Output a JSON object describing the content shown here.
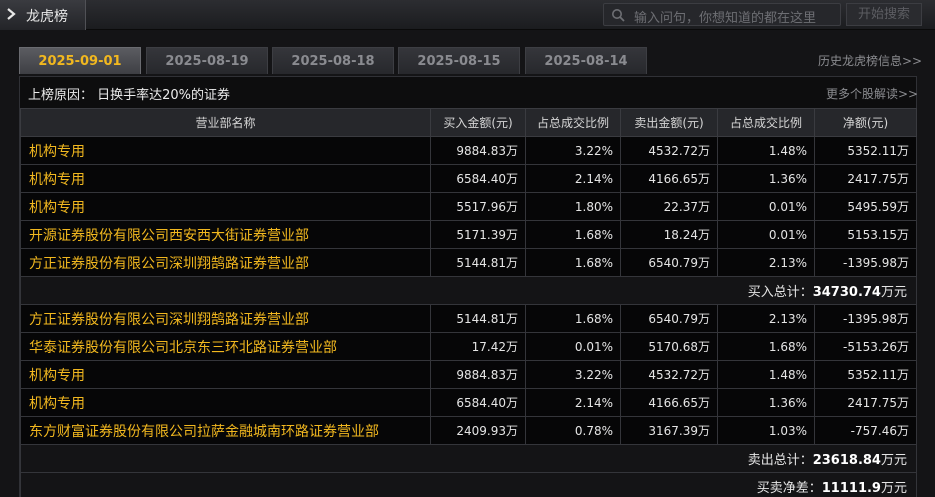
{
  "header": {
    "title": "龙虎榜",
    "search_placeholder": "输入问句，你想知道的都在这里",
    "search_button": "开始搜索"
  },
  "tabs": [
    {
      "label": "2025-09-01",
      "active": true
    },
    {
      "label": "2025-08-19",
      "active": false
    },
    {
      "label": "2025-08-18",
      "active": false
    },
    {
      "label": "2025-08-15",
      "active": false
    },
    {
      "label": "2025-08-14",
      "active": false
    }
  ],
  "history_link": "历史龙虎榜信息>>",
  "reason": {
    "text": "上榜原因：  日换手率达20%的证券",
    "more_link": "更多个股解读>>"
  },
  "table": {
    "columns": [
      "营业部名称",
      "买入金额(元)",
      "占总成交比例",
      "卖出金额(元)",
      "占总成交比例",
      "净额(元)"
    ],
    "buy_rows": [
      [
        "机构专用",
        "9884.83万",
        "3.22%",
        "4532.72万",
        "1.48%",
        "5352.11万"
      ],
      [
        "机构专用",
        "6584.40万",
        "2.14%",
        "4166.65万",
        "1.36%",
        "2417.75万"
      ],
      [
        "机构专用",
        "5517.96万",
        "1.80%",
        "22.37万",
        "0.01%",
        "5495.59万"
      ],
      [
        "开源证券股份有限公司西安西大街证券营业部",
        "5171.39万",
        "1.68%",
        "18.24万",
        "0.01%",
        "5153.15万"
      ],
      [
        "方正证券股份有限公司深圳翔鹄路证券营业部",
        "5144.81万",
        "1.68%",
        "6540.79万",
        "2.13%",
        "-1395.98万"
      ]
    ],
    "buy_total": {
      "label": "买入总计：",
      "value": "34730.74",
      "unit": "万元"
    },
    "sell_rows": [
      [
        "方正证券股份有限公司深圳翔鹄路证券营业部",
        "5144.81万",
        "1.68%",
        "6540.79万",
        "2.13%",
        "-1395.98万"
      ],
      [
        "华泰证券股份有限公司北京东三环北路证券营业部",
        "17.42万",
        "0.01%",
        "5170.68万",
        "1.68%",
        "-5153.26万"
      ],
      [
        "机构专用",
        "9884.83万",
        "3.22%",
        "4532.72万",
        "1.48%",
        "5352.11万"
      ],
      [
        "机构专用",
        "6584.40万",
        "2.14%",
        "4166.65万",
        "1.36%",
        "2417.75万"
      ],
      [
        "东方财富证券股份有限公司拉萨金融城南环路证券营业部",
        "2409.93万",
        "0.78%",
        "3167.39万",
        "1.03%",
        "-757.46万"
      ]
    ],
    "sell_total": {
      "label": "卖出总计：",
      "value": "23618.84",
      "unit": "万元"
    },
    "net_total": {
      "label": "买卖净差：",
      "value": "11111.9",
      "unit": "万元"
    }
  },
  "colors": {
    "accent": "#f2b81f",
    "background": "#141416",
    "row_bg": "#060607"
  }
}
